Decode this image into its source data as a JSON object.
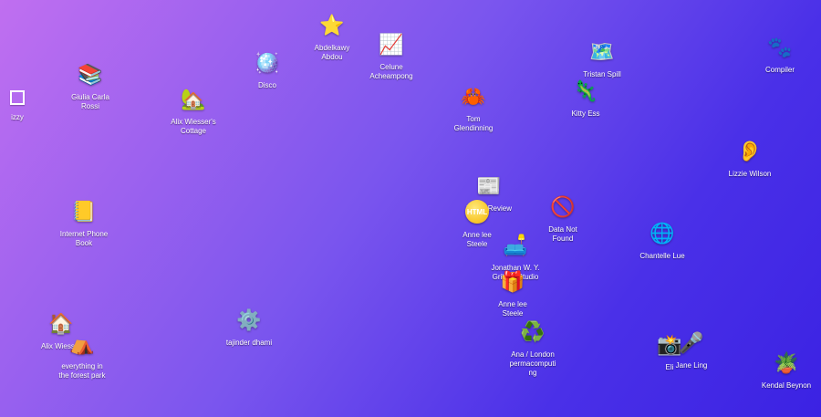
{
  "icons": [
    {
      "id": "izzy",
      "label": "izzy",
      "glyph": "",
      "icon_name": "square-outline-icon"
    },
    {
      "id": "giulia",
      "label": "Giulia Carla\nRossi",
      "glyph": "📚",
      "icon_name": "books-icon"
    },
    {
      "id": "alix-cottage",
      "label": "Alix Wiesser's\nCottage",
      "glyph": "🏡",
      "icon_name": "house-with-garden-icon"
    },
    {
      "id": "disco",
      "label": "Disco",
      "glyph": "🪩",
      "icon_name": "disco-ball-icon"
    },
    {
      "id": "abdelkawy",
      "label": "Abdelkawy\nAbdou",
      "glyph": "⭐",
      "icon_name": "star-icon"
    },
    {
      "id": "celune",
      "label": "Celune\nAcheampong",
      "glyph": "📈",
      "icon_name": "chart-increasing-icon"
    },
    {
      "id": "tom",
      "label": "Tom\nGlendinning",
      "glyph": "🦀",
      "icon_name": "crab-icon"
    },
    {
      "id": "tristan",
      "label": "Tristan Spill",
      "glyph": "🗺️",
      "icon_name": "map-icon"
    },
    {
      "id": "kitty",
      "label": "Kitty Ess",
      "glyph": "🦎",
      "icon_name": "lizard-icon"
    },
    {
      "id": "compiler",
      "label": "Compiler",
      "glyph": "🐾",
      "icon_name": "paw-prints-icon"
    },
    {
      "id": "lizzie",
      "label": "Lizzie Wilson",
      "glyph": "👂",
      "icon_name": "ear-icon"
    },
    {
      "id": "internet-phone",
      "label": "Internet Phone\nBook",
      "glyph": "📒",
      "icon_name": "notebook-icon"
    },
    {
      "id": "html-review",
      "label": "HTML Review",
      "glyph": "📰",
      "icon_name": "newspaper-icon"
    },
    {
      "id": "anne1",
      "label": "Anne lee\nSteele",
      "glyph": "HTML",
      "icon_name": "html-badge-icon"
    },
    {
      "id": "data-not-found",
      "label": "Data Not\nFound",
      "glyph": "🚫",
      "icon_name": "prohibited-icon"
    },
    {
      "id": "chantelle",
      "label": "Chantelle Lue",
      "glyph": "🌐",
      "icon_name": "globe-icon"
    },
    {
      "id": "jonathan",
      "label": "Jonathan W. Y.\nGribbin Studio",
      "glyph": "🛋️",
      "icon_name": "couch-icon"
    },
    {
      "id": "anne2",
      "label": "Anne lee\nSteele",
      "glyph": "🎁",
      "icon_name": "gift-icon"
    },
    {
      "id": "tajinder",
      "label": "tajinder dhami",
      "glyph": "⚙️",
      "icon_name": "gear-icon"
    },
    {
      "id": "alix2",
      "label": "Alix Wiesser",
      "glyph": "🏠",
      "icon_name": "house-icon"
    },
    {
      "id": "everything",
      "label": "everything in\nthe forest park",
      "glyph": "⛺",
      "icon_name": "tent-icon"
    },
    {
      "id": "ana",
      "label": "Ana / London\npermacomputi\nng",
      "glyph": "♻️",
      "icon_name": "recycle-icon"
    },
    {
      "id": "eli",
      "label": "Eli",
      "glyph": "📸",
      "icon_name": "camera-flash-icon"
    },
    {
      "id": "jane",
      "label": "Jane Ling",
      "glyph": "🎤",
      "icon_name": "microphone-icon"
    },
    {
      "id": "kendal",
      "label": "Kendal Beynon",
      "glyph": "🪴",
      "icon_name": "potted-plant-icon"
    }
  ]
}
